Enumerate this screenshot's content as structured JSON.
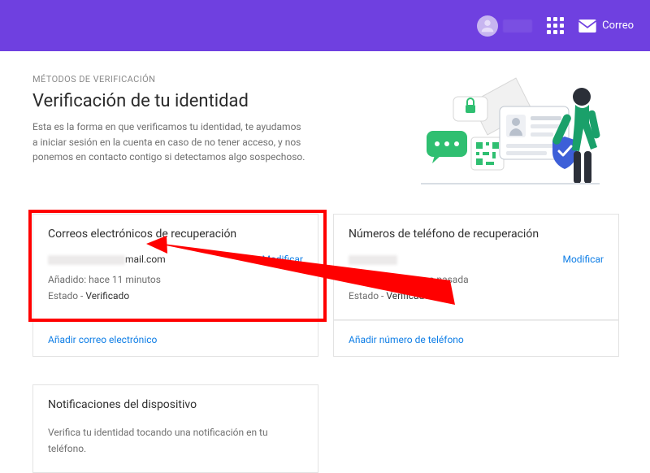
{
  "topbar": {
    "mail_label": "Correo"
  },
  "header": {
    "eyebrow": "MÉTODOS DE VERIFICACIÓN",
    "title": "Verificación de tu identidad",
    "description": "Esta es la forma en que verificamos tu identidad, te ayudamos a iniciar sesión en la cuenta en caso de no tener acceso, y nos ponemos en contacto contigo si detectamos algo sospechoso."
  },
  "recovery_email": {
    "card_title": "Correos electrónicos de recuperación",
    "value_suffix": "mail.com",
    "modify": "Modificar",
    "added_label": "Añadido:",
    "added_value": "hace 11 minutos",
    "status_label": "Estado -",
    "status_value": "Verificado",
    "add_link": "Añadir correo electrónico"
  },
  "recovery_phone": {
    "card_title": "Números de teléfono de recuperación",
    "modify": "Modificar",
    "added_label": "Añadido:",
    "added_value": "la semana pasada",
    "status_label": "Estado -",
    "status_value": "Verificado",
    "add_link": "Añadir número de teléfono"
  },
  "device_notifications": {
    "card_title": "Notificaciones del dispositivo",
    "description": "Verifica tu identidad tocando una notificación en tu teléfono."
  }
}
